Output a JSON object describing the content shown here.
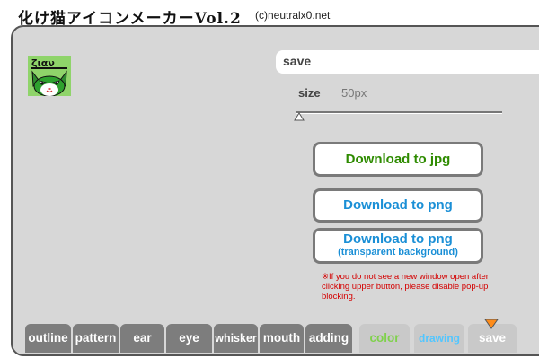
{
  "header": {
    "title": "化け猫アイコンメーカーVol.2",
    "copyright": "(c)neutralx0.net"
  },
  "preview": {
    "icon": "cat-icon",
    "icon_text": "ζιαν"
  },
  "save_panel": {
    "heading": "save",
    "size_label": "size",
    "size_value": "50px",
    "buttons": {
      "jpg": "Download to jpg",
      "png": "Download to png",
      "png_transparent_line1": "Download to png",
      "png_transparent_line2": "(transparent background)"
    },
    "note": "※If you do not see a new window open after clicking upper button, please disable pop-up blocking."
  },
  "tabs": [
    {
      "label": "outline",
      "color": "#ffffff"
    },
    {
      "label": "pattern",
      "color": "#ffffff"
    },
    {
      "label": "ear",
      "color": "#ffffff"
    },
    {
      "label": "eye",
      "color": "#ffffff"
    },
    {
      "label": "whisker",
      "color": "#ffffff"
    },
    {
      "label": "mouth",
      "color": "#ffffff"
    },
    {
      "label": "adding",
      "color": "#ffffff"
    },
    {
      "label": "color",
      "color": "#7fd14b"
    },
    {
      "label": "drawing",
      "color": "#52c6ff"
    },
    {
      "label": "save",
      "color": "#ffffff"
    }
  ],
  "active_tab": "save",
  "colors": {
    "panel_bg": "#d7d7d7",
    "jpg_text": "#2e8b00",
    "png_text": "#1a8fd6",
    "note_text": "#d40000",
    "active_marker": "#ff8c1a"
  }
}
